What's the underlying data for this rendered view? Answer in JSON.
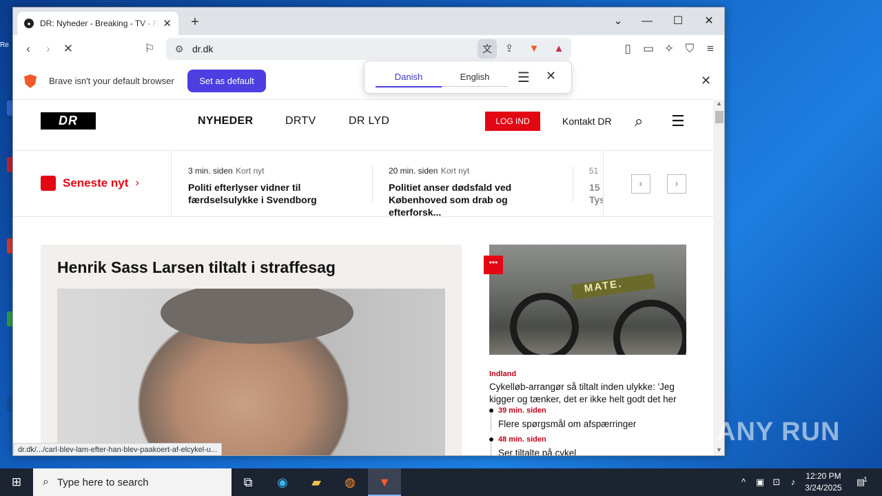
{
  "browser": {
    "tab_title": "DR: Nyheder - Breaking - TV - R",
    "url": "dr.dk",
    "infobar": {
      "message": "Brave isn't your default browser",
      "button": "Set as default"
    },
    "translate": {
      "lang_from": "Danish",
      "lang_to": "English"
    },
    "status_link": "dr.dk/.../carl-blev-lam-efter-han-blev-paakoert-af-elcykel-u..."
  },
  "site": {
    "logo": "DR",
    "nav": [
      "NYHEDER",
      "DRTV",
      "DR LYD"
    ],
    "login": "LOG IND",
    "contact": "Kontakt DR"
  },
  "ticker": {
    "label": "Seneste nyt",
    "items": [
      {
        "time": "3 min. siden",
        "tag": "Kort nyt",
        "headline": "Politi efterlyser vidner til færdselsulykke i Svendborg"
      },
      {
        "time": "20 min. siden",
        "tag": "Kort nyt",
        "headline": "Politiet anser dødsfald ved Københoved som drab og efterforsk..."
      },
      {
        "time": "51",
        "tag": "",
        "headline": "15 Tys"
      }
    ]
  },
  "hero": {
    "headline": "Henrik Sass Larsen tiltalt i straffesag"
  },
  "side_story": {
    "category": "Indland",
    "headline": "Cykelløb-arrangør så tiltalt inden ulykke: 'Jeg kigger og tænker, det er ikke helt godt det her",
    "bike_text": "MATE.",
    "updates": [
      {
        "time": "39 min. siden",
        "text": "Flere spørgsmål om afspærringer"
      },
      {
        "time": "48 min. siden",
        "text": "Ser tiltalte på cykel"
      }
    ]
  },
  "watermark": "ANY RUN",
  "taskbar": {
    "search_placeholder": "Type here to search",
    "time": "12:20 PM",
    "date": "3/24/2025",
    "notification_count": "1"
  }
}
